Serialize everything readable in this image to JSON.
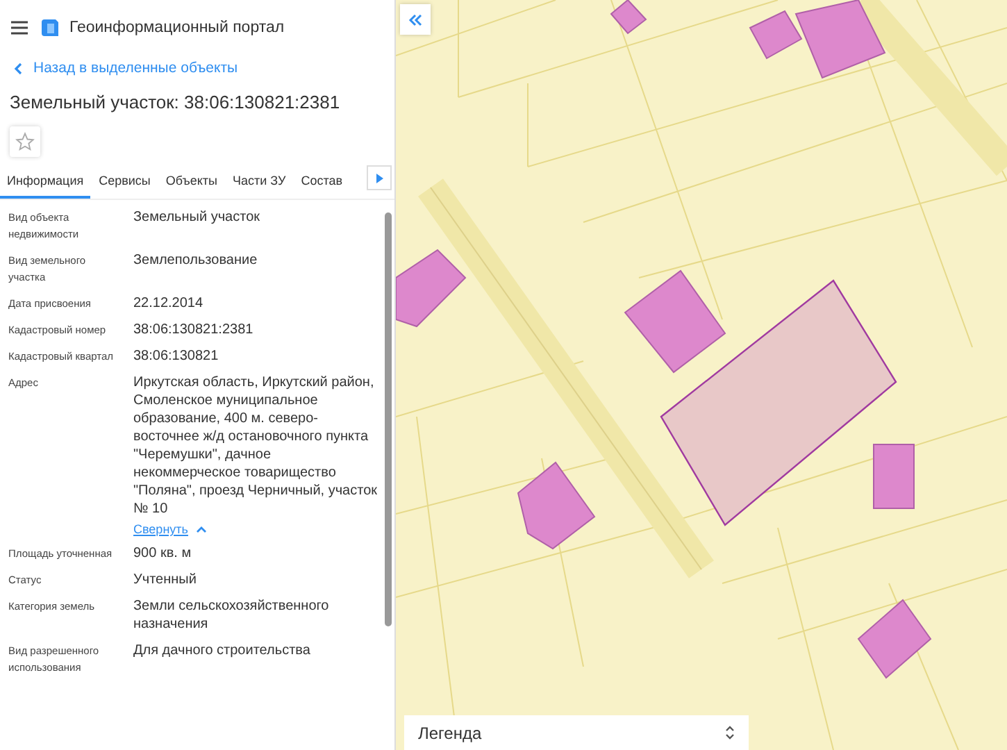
{
  "header": {
    "title": "Геоинформационный портал"
  },
  "back_link": "Назад в выделенные объекты",
  "object_title": "Земельный участок: 38:06:130821:2381",
  "favorite": {
    "on": false
  },
  "tabs": [
    {
      "label": "Информация",
      "selected": true
    },
    {
      "label": "Сервисы",
      "selected": false
    },
    {
      "label": "Объекты",
      "selected": false
    },
    {
      "label": "Части ЗУ",
      "selected": false
    },
    {
      "label": "Состав",
      "selected": false
    }
  ],
  "fields": [
    {
      "label": "Вид объекта недвижимости",
      "value": "Земельный участок"
    },
    {
      "label": "Вид земельного участка",
      "value": "Землепользование"
    },
    {
      "label": "Дата присвоения",
      "value": "22.12.2014"
    },
    {
      "label": "Кадастровый номер",
      "value": "38:06:130821:2381"
    },
    {
      "label": "Кадастровый квартал",
      "value": "38:06:130821"
    },
    {
      "label": "Адрес",
      "value": "Иркутская область, Иркутский район, Смоленское муниципальное образование, 400 м. северо-восточнее ж/д остановочного пункта \"Черемушки\", дачное некоммерческое товарищество \"Поляна\", проезд Черничный, участок № 10",
      "link": "Свернуть"
    },
    {
      "label": "Площадь уточненная",
      "value": "900 кв. м"
    },
    {
      "label": "Статус",
      "value": "Учтенный"
    },
    {
      "label": "Категория земель",
      "value": "Земли сельскохозяйственного назначения"
    },
    {
      "label": "Вид разрешенного использования",
      "value": "Для дачного строительства"
    }
  ],
  "legend": {
    "title": "Легенда",
    "expanded": false
  }
}
